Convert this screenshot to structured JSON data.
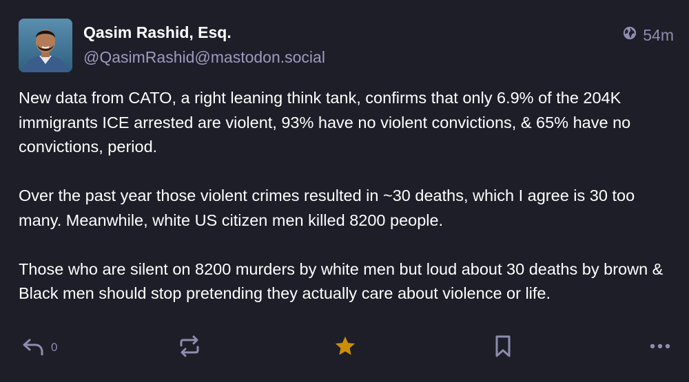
{
  "author": {
    "display_name": "Qasim Rashid, Esq.",
    "handle": "@QasimRashid@mastodon.social",
    "avatar_icon": "avatar"
  },
  "meta": {
    "visibility_icon": "globe-icon",
    "timestamp": "54m"
  },
  "content": {
    "paragraphs": [
      "New data from CATO, a right leaning think tank, confirms that only 6.9% of the 204K immigrants ICE arrested are violent, 93% have no violent convictions, & 65% have no convictions, period.",
      "Over the past year those violent crimes resulted in ~30 deaths, which I agree is 30 too many. Meanwhile, white US citizen men killed 8200 people.",
      "Those who are silent on 8200 murders by white men but loud about 30 deaths by brown & Black men should stop pretending they actually care about violence or life."
    ]
  },
  "actions": {
    "reply_count": "0",
    "reply_icon": "reply-icon",
    "boost_icon": "boost-icon",
    "favourite_icon": "star-icon",
    "bookmark_icon": "bookmark-icon",
    "more_icon": "more-icon"
  },
  "colors": {
    "background": "#1e1e29",
    "handle": "#9b9bbf",
    "icon": "#8d8db0",
    "favourite_active": "#ca8f04"
  }
}
